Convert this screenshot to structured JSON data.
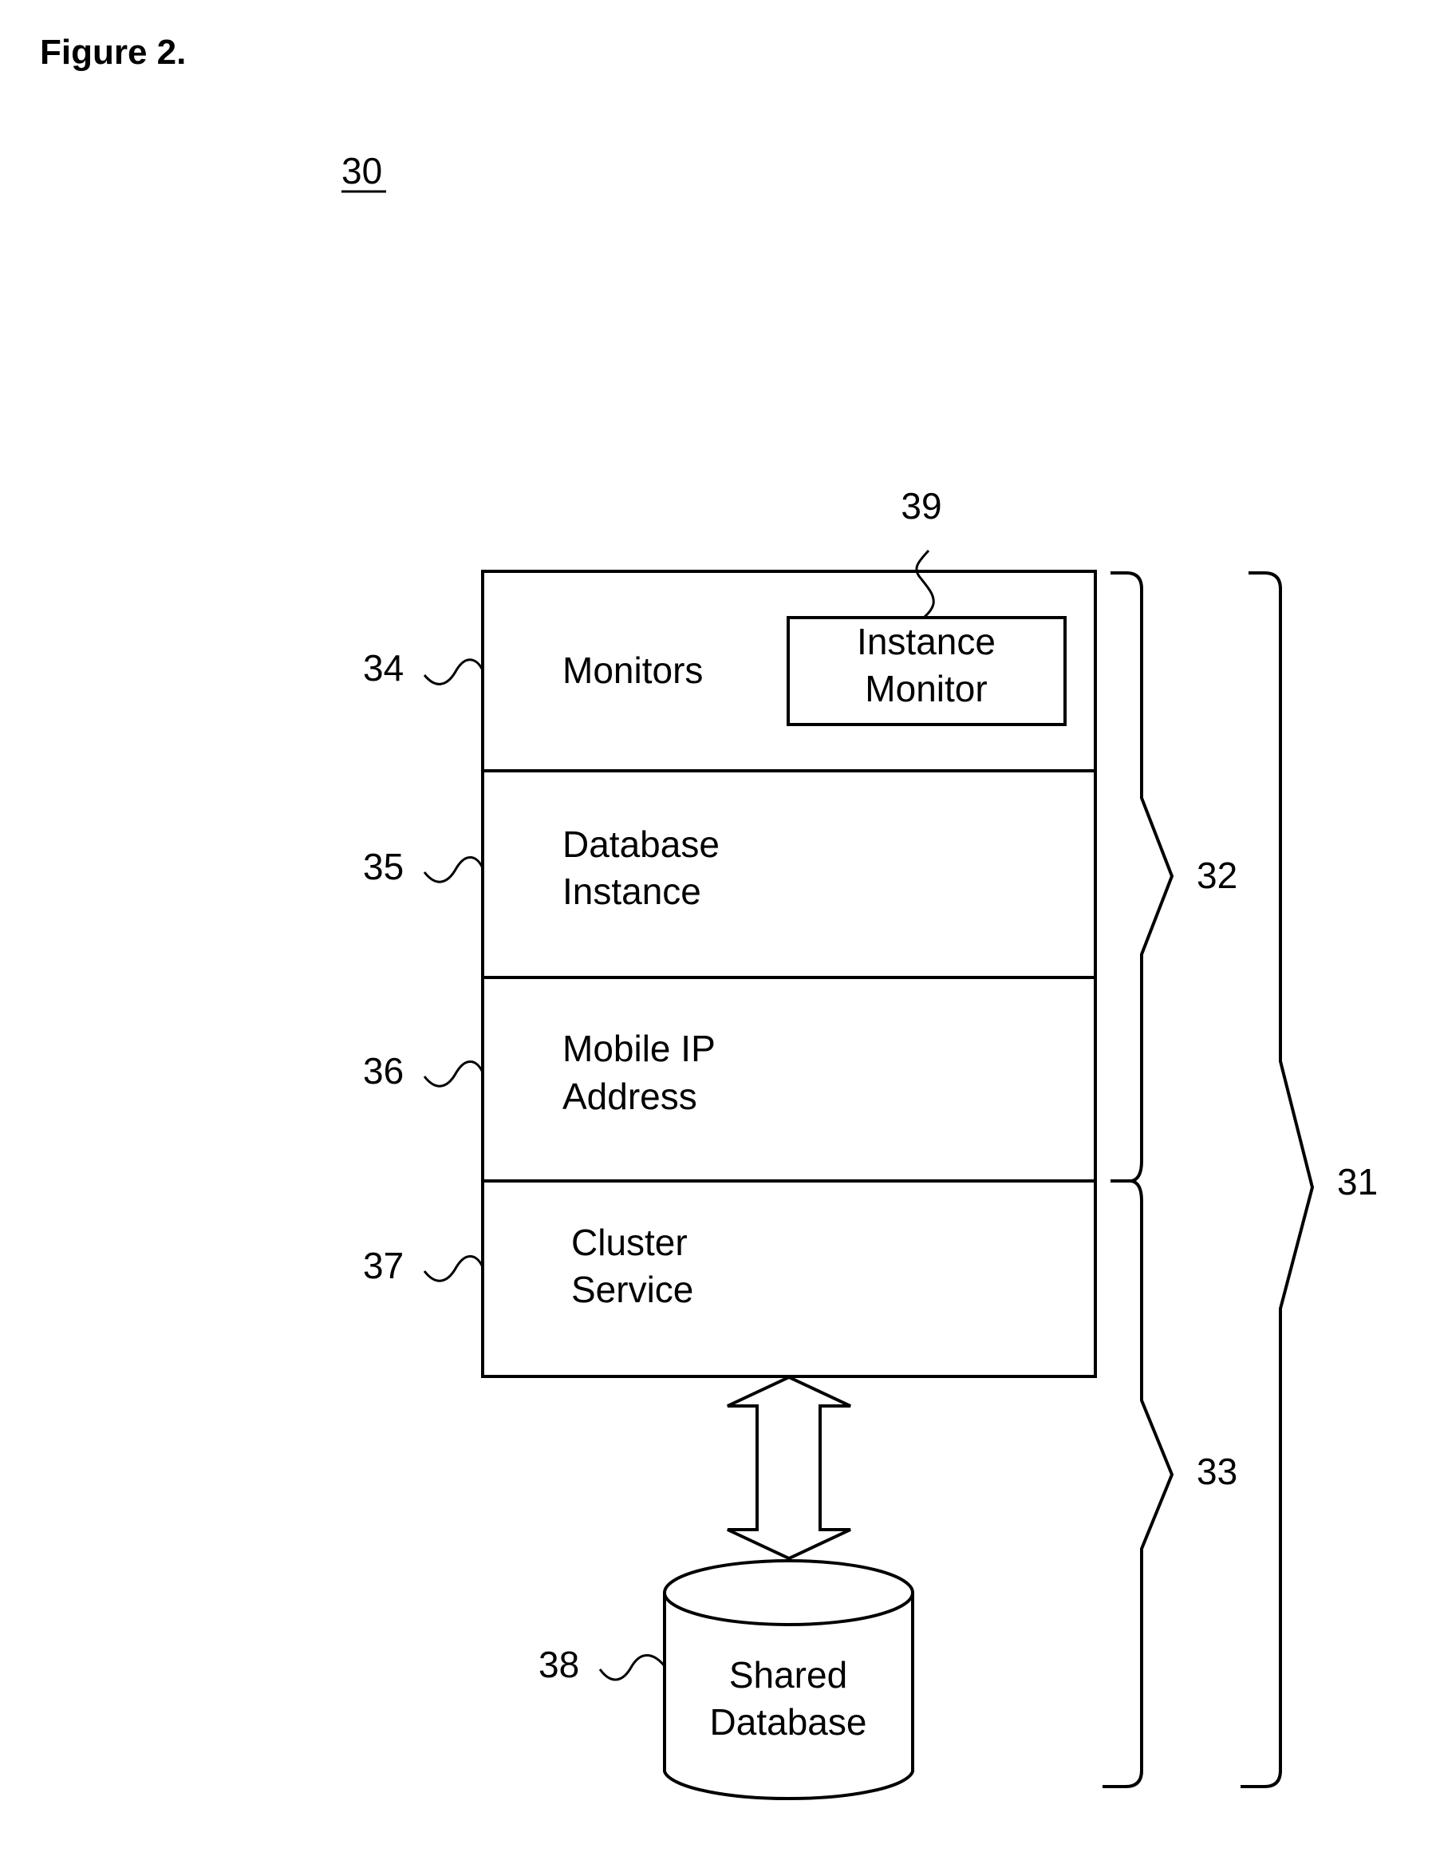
{
  "figure": {
    "title": "Figure 2.",
    "reference": "30"
  },
  "stack": {
    "layers": [
      {
        "ref": "34",
        "lines": [
          "Monitors"
        ]
      },
      {
        "ref": "35",
        "lines": [
          "Database",
          "Instance"
        ]
      },
      {
        "ref": "36",
        "lines": [
          "Mobile IP",
          "Address"
        ]
      },
      {
        "ref": "37",
        "lines": [
          "Cluster",
          "Service"
        ]
      }
    ],
    "instance_monitor": {
      "ref": "39",
      "lines": [
        "Instance",
        "Monitor"
      ]
    }
  },
  "shared_database": {
    "ref": "38",
    "lines": [
      "Shared",
      "Database"
    ]
  },
  "braces": [
    {
      "ref": "32",
      "spans": "Monitors through Mobile IP Address"
    },
    {
      "ref": "33",
      "spans": "Cluster Service and Shared Database"
    },
    {
      "ref": "31",
      "spans": "entire node"
    }
  ],
  "connector": {
    "type": "bidirectional-arrow",
    "between": [
      "Cluster Service",
      "Shared Database"
    ]
  }
}
